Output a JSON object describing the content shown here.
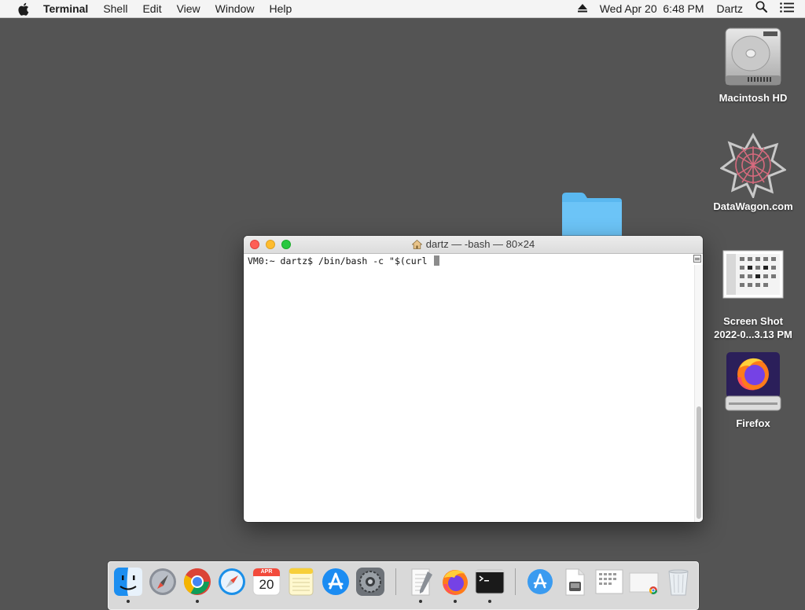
{
  "menubar": {
    "app_name": "Terminal",
    "menus": [
      "Shell",
      "Edit",
      "View",
      "Window",
      "Help"
    ],
    "datetime": "Wed Apr 20  6:48 PM",
    "user": "Dartz"
  },
  "desktop": {
    "icons": [
      {
        "label": "Macintosh HD",
        "icon": "hard-drive-icon"
      },
      {
        "label": "DataWagon.com",
        "icon": "datawagon-logo-icon"
      },
      {
        "label": "Screen Shot\n2022-0...3.13 PM",
        "icon": "screenshot-thumbnail-icon"
      },
      {
        "label": "Firefox",
        "icon": "firefox-installer-icon"
      }
    ],
    "folder_icon": "folder-icon"
  },
  "terminal": {
    "title": "dartz — -bash — 80×24",
    "prompt": "VM0:~ dartz$ ",
    "command": "/bin/bash -c \"$(curl "
  },
  "dock": {
    "items": [
      {
        "icon": "finder-icon",
        "running": true
      },
      {
        "icon": "launchpad-icon",
        "running": false
      },
      {
        "icon": "chrome-icon",
        "running": true
      },
      {
        "icon": "safari-icon",
        "running": false
      },
      {
        "icon": "calendar-icon",
        "running": false,
        "calendar_month": "APR",
        "calendar_day": "20"
      },
      {
        "icon": "notes-icon",
        "running": false
      },
      {
        "icon": "app-store-icon",
        "running": false
      },
      {
        "icon": "system-preferences-icon",
        "running": false
      },
      {
        "icon": "textedit-icon",
        "running": true
      },
      {
        "icon": "firefox-icon",
        "running": true
      },
      {
        "icon": "terminal-icon",
        "running": true
      },
      {
        "icon": "app-store-folder-icon",
        "running": false
      },
      {
        "icon": "document-icon",
        "running": false
      },
      {
        "icon": "screenshot-icon",
        "running": false
      },
      {
        "icon": "chrome-window-icon",
        "running": false
      },
      {
        "icon": "trash-icon",
        "running": false
      }
    ]
  },
  "colors": {
    "desktop_bg": "#545454",
    "menubar_bg": "#f4f4f4",
    "close": "#fe5f57",
    "minimize": "#febc2e",
    "zoom": "#28c840",
    "folder_blue": "#5ab8f0"
  }
}
